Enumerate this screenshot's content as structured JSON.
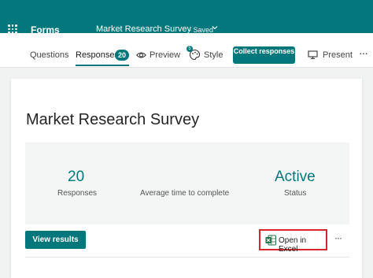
{
  "app": {
    "name": "Forms",
    "survey_title": "Market Research Survey",
    "save_status": "Saved"
  },
  "command_bar": {
    "tabs": {
      "questions": "Questions",
      "responses": "Responses",
      "responses_count": "20",
      "preview": "Preview",
      "style": "Style",
      "style_badge": "5",
      "present": "Present"
    },
    "collect_button": "Collect responses",
    "active_tab": "Responses"
  },
  "main": {
    "title": "Market Research Survey",
    "stats": [
      {
        "value": "20",
        "label": "Responses"
      },
      {
        "value": "",
        "label": "Average time to complete"
      },
      {
        "value": "Active",
        "label": "Status"
      }
    ],
    "view_results_button": "View results",
    "open_excel_button": "Open in Excel"
  },
  "icons": {
    "app_launcher": "waffle-icon",
    "dropdown": "chevron-down-icon",
    "preview": "eye-icon",
    "style": "palette-icon",
    "present": "monitor-icon",
    "excel": "excel-icon",
    "more": "more-icon"
  },
  "colors": {
    "brand": "#03787c",
    "highlight_border": "#d7262b",
    "excel_green": "#1d7044"
  }
}
